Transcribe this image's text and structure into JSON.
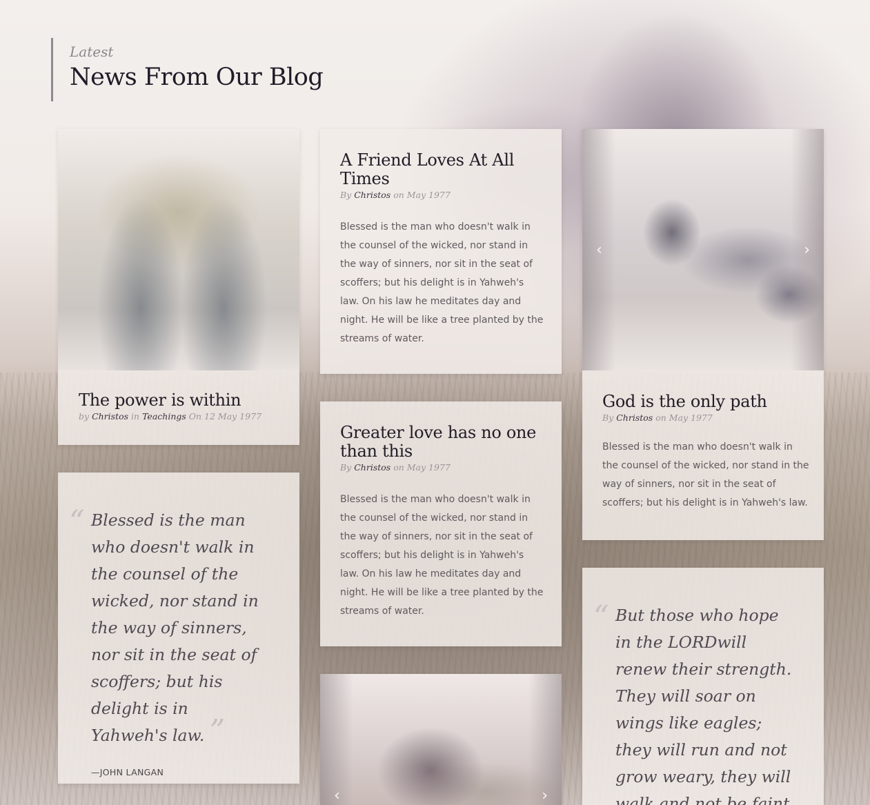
{
  "section": {
    "kicker": "Latest",
    "title": "News From Our Blog"
  },
  "posts": {
    "power": {
      "title": "The power is within",
      "by": "by",
      "author": "Christos",
      "in": "in",
      "category": "Teachings",
      "on": "On 12 May 1977"
    },
    "friend": {
      "title": "A Friend Loves At All Times",
      "by": "By",
      "author": "Christos",
      "on": "on May 1977",
      "excerpt": "Blessed is the man who doesn't walk in the counsel of the wicked, nor stand in the way of sinners, nor sit in the seat of scoffers; but his delight is in Yahweh's law. On his law he meditates day and night. He will be like a tree planted by the streams of water."
    },
    "god": {
      "title": "God is the only path",
      "by": "By",
      "author": "Christos",
      "on": "on May 1977",
      "excerpt": "Blessed is the man who doesn't walk in the counsel of the wicked, nor stand in the way of sinners, nor sit in the seat of scoffers; but his delight is in Yahweh's law."
    },
    "greater": {
      "title": "Greater love has no one than this",
      "by": "By",
      "author": "Christos",
      "on": "on May 1977",
      "excerpt": "Blessed is the man who doesn't walk in the counsel of the wicked, nor stand in the way of sinners, nor sit in the seat of scoffers; but his delight is in Yahweh's law. On his law he meditates day and night. He will be like a tree planted by the streams of water."
    }
  },
  "quotes": {
    "blessed": {
      "text": "Blessed is the man who doesn't walk in the counsel of the wicked, nor stand in the way of sinners, nor sit in the seat of scoffers; but his delight is in Yahweh's law.",
      "author": "—JOHN LANGAN"
    },
    "hope": {
      "text": "But those who hope in the LORDwill renew their strength. They will soar on wings like eagles; they will run and not grow weary, they will walk and not be faint."
    }
  },
  "gallery": {
    "prev_icon": "‹",
    "next_icon": "›"
  },
  "icons": {
    "open_quote": "“",
    "close_quote": "”"
  }
}
